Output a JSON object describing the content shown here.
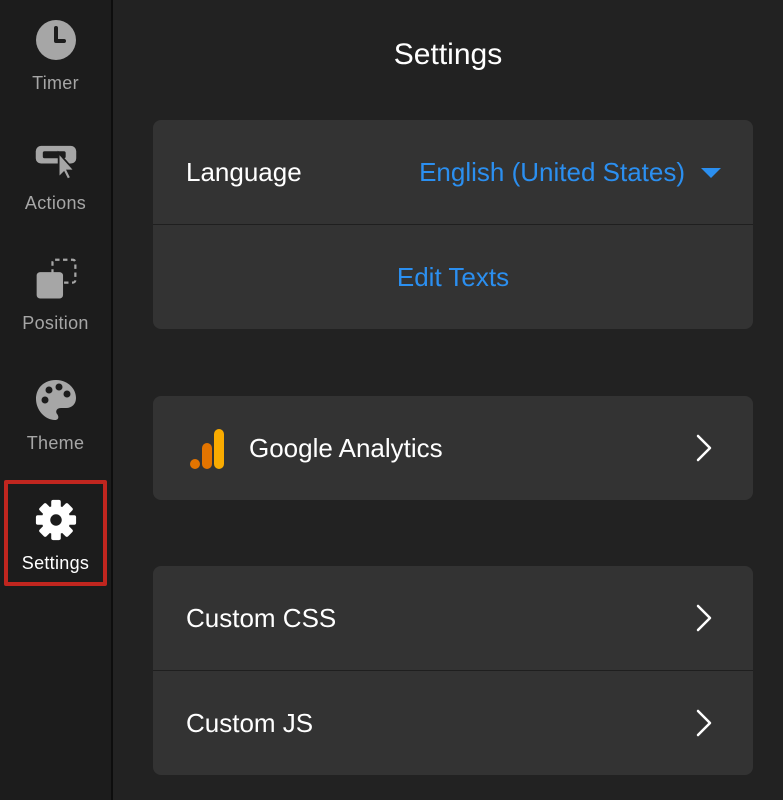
{
  "sidebar": {
    "items": [
      {
        "label": "Timer",
        "icon": "clock-icon"
      },
      {
        "label": "Actions",
        "icon": "cursor-button-icon"
      },
      {
        "label": "Position",
        "icon": "position-icon"
      },
      {
        "label": "Theme",
        "icon": "palette-icon"
      },
      {
        "label": "Settings",
        "icon": "gear-icon",
        "active": true
      }
    ]
  },
  "header": {
    "title": "Settings"
  },
  "language_card": {
    "language_label": "Language",
    "language_value": "English (United States)",
    "edit_texts_label": "Edit Texts"
  },
  "analytics_card": {
    "label": "Google Analytics",
    "icon": "google-analytics-icon"
  },
  "custom_card": {
    "css_label": "Custom CSS",
    "js_label": "Custom JS"
  },
  "colors": {
    "accent": "#2b8ff0",
    "active_border": "#c0261f",
    "card_bg": "#333333",
    "ga_orange": "#f9ab00",
    "ga_dark_orange": "#e37400"
  }
}
